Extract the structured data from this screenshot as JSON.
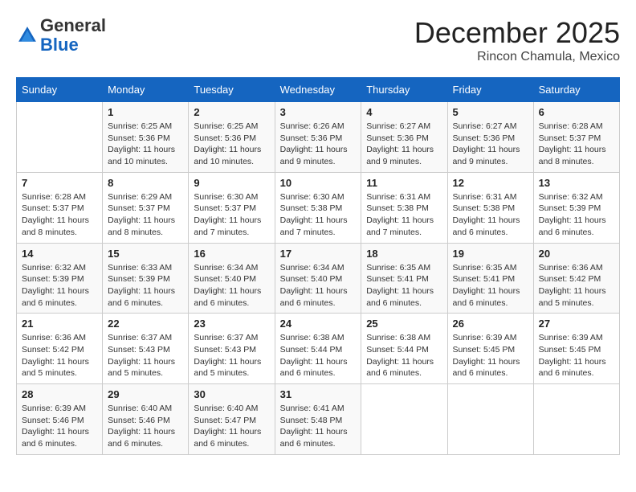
{
  "header": {
    "logo_line1": "General",
    "logo_line2": "Blue",
    "month": "December 2025",
    "location": "Rincon Chamula, Mexico"
  },
  "weekdays": [
    "Sunday",
    "Monday",
    "Tuesday",
    "Wednesday",
    "Thursday",
    "Friday",
    "Saturday"
  ],
  "weeks": [
    [
      {
        "day": "",
        "info": ""
      },
      {
        "day": "1",
        "info": "Sunrise: 6:25 AM\nSunset: 5:36 PM\nDaylight: 11 hours and 10 minutes."
      },
      {
        "day": "2",
        "info": "Sunrise: 6:25 AM\nSunset: 5:36 PM\nDaylight: 11 hours and 10 minutes."
      },
      {
        "day": "3",
        "info": "Sunrise: 6:26 AM\nSunset: 5:36 PM\nDaylight: 11 hours and 9 minutes."
      },
      {
        "day": "4",
        "info": "Sunrise: 6:27 AM\nSunset: 5:36 PM\nDaylight: 11 hours and 9 minutes."
      },
      {
        "day": "5",
        "info": "Sunrise: 6:27 AM\nSunset: 5:36 PM\nDaylight: 11 hours and 9 minutes."
      },
      {
        "day": "6",
        "info": "Sunrise: 6:28 AM\nSunset: 5:37 PM\nDaylight: 11 hours and 8 minutes."
      }
    ],
    [
      {
        "day": "7",
        "info": "Sunrise: 6:28 AM\nSunset: 5:37 PM\nDaylight: 11 hours and 8 minutes."
      },
      {
        "day": "8",
        "info": "Sunrise: 6:29 AM\nSunset: 5:37 PM\nDaylight: 11 hours and 8 minutes."
      },
      {
        "day": "9",
        "info": "Sunrise: 6:30 AM\nSunset: 5:37 PM\nDaylight: 11 hours and 7 minutes."
      },
      {
        "day": "10",
        "info": "Sunrise: 6:30 AM\nSunset: 5:38 PM\nDaylight: 11 hours and 7 minutes."
      },
      {
        "day": "11",
        "info": "Sunrise: 6:31 AM\nSunset: 5:38 PM\nDaylight: 11 hours and 7 minutes."
      },
      {
        "day": "12",
        "info": "Sunrise: 6:31 AM\nSunset: 5:38 PM\nDaylight: 11 hours and 6 minutes."
      },
      {
        "day": "13",
        "info": "Sunrise: 6:32 AM\nSunset: 5:39 PM\nDaylight: 11 hours and 6 minutes."
      }
    ],
    [
      {
        "day": "14",
        "info": "Sunrise: 6:32 AM\nSunset: 5:39 PM\nDaylight: 11 hours and 6 minutes."
      },
      {
        "day": "15",
        "info": "Sunrise: 6:33 AM\nSunset: 5:39 PM\nDaylight: 11 hours and 6 minutes."
      },
      {
        "day": "16",
        "info": "Sunrise: 6:34 AM\nSunset: 5:40 PM\nDaylight: 11 hours and 6 minutes."
      },
      {
        "day": "17",
        "info": "Sunrise: 6:34 AM\nSunset: 5:40 PM\nDaylight: 11 hours and 6 minutes."
      },
      {
        "day": "18",
        "info": "Sunrise: 6:35 AM\nSunset: 5:41 PM\nDaylight: 11 hours and 6 minutes."
      },
      {
        "day": "19",
        "info": "Sunrise: 6:35 AM\nSunset: 5:41 PM\nDaylight: 11 hours and 6 minutes."
      },
      {
        "day": "20",
        "info": "Sunrise: 6:36 AM\nSunset: 5:42 PM\nDaylight: 11 hours and 5 minutes."
      }
    ],
    [
      {
        "day": "21",
        "info": "Sunrise: 6:36 AM\nSunset: 5:42 PM\nDaylight: 11 hours and 5 minutes."
      },
      {
        "day": "22",
        "info": "Sunrise: 6:37 AM\nSunset: 5:43 PM\nDaylight: 11 hours and 5 minutes."
      },
      {
        "day": "23",
        "info": "Sunrise: 6:37 AM\nSunset: 5:43 PM\nDaylight: 11 hours and 5 minutes."
      },
      {
        "day": "24",
        "info": "Sunrise: 6:38 AM\nSunset: 5:44 PM\nDaylight: 11 hours and 6 minutes."
      },
      {
        "day": "25",
        "info": "Sunrise: 6:38 AM\nSunset: 5:44 PM\nDaylight: 11 hours and 6 minutes."
      },
      {
        "day": "26",
        "info": "Sunrise: 6:39 AM\nSunset: 5:45 PM\nDaylight: 11 hours and 6 minutes."
      },
      {
        "day": "27",
        "info": "Sunrise: 6:39 AM\nSunset: 5:45 PM\nDaylight: 11 hours and 6 minutes."
      }
    ],
    [
      {
        "day": "28",
        "info": "Sunrise: 6:39 AM\nSunset: 5:46 PM\nDaylight: 11 hours and 6 minutes."
      },
      {
        "day": "29",
        "info": "Sunrise: 6:40 AM\nSunset: 5:46 PM\nDaylight: 11 hours and 6 minutes."
      },
      {
        "day": "30",
        "info": "Sunrise: 6:40 AM\nSunset: 5:47 PM\nDaylight: 11 hours and 6 minutes."
      },
      {
        "day": "31",
        "info": "Sunrise: 6:41 AM\nSunset: 5:48 PM\nDaylight: 11 hours and 6 minutes."
      },
      {
        "day": "",
        "info": ""
      },
      {
        "day": "",
        "info": ""
      },
      {
        "day": "",
        "info": ""
      }
    ]
  ]
}
